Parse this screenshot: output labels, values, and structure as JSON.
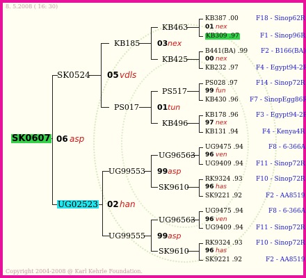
{
  "header": {
    "date": "8. 5.2008 ( 16: 30)"
  },
  "footer": {
    "copyright": "Copyright 2004-2008 @ Karl Kehrle Foundation."
  },
  "root": {
    "name": "SK0607",
    "num": "06",
    "col": "asp"
  },
  "sire": {
    "name": "SK0524",
    "num": "05",
    "col": "vdls"
  },
  "dam": {
    "name": "UG02523",
    "num": "02",
    "col": "han"
  },
  "gen3": [
    {
      "name": "KB185",
      "num": "03",
      "col": "nex"
    },
    {
      "name": "PS017",
      "num": "01",
      "col": "tun"
    },
    {
      "name": "UG99553",
      "num": "99",
      "col": "asp"
    },
    {
      "name": "UG99555",
      "num": "99",
      "col": "asp"
    }
  ],
  "gen4": [
    {
      "name": "KB463",
      "num": "01",
      "col": "nex"
    },
    {
      "name": "KB425",
      "num": "00",
      "col": "nex"
    },
    {
      "name": "PS517",
      "num": "99",
      "col": "fun"
    },
    {
      "name": "KB496",
      "num": "97",
      "col": "nex"
    },
    {
      "name": "UG96563",
      "num": "96",
      "col": "ven"
    },
    {
      "name": "SK9610",
      "num": "96",
      "col": "has"
    },
    {
      "name": "UG96563",
      "num": "96",
      "col": "ven"
    },
    {
      "name": "SK9610",
      "num": "96",
      "col": "has"
    }
  ],
  "gen5": [
    {
      "name": "KB387 .00",
      "info": "F18 - Sinop62R"
    },
    {
      "name": "KB309 .97",
      "info": "F1 - Sinop96R"
    },
    {
      "name": "B441(BA) .99",
      "info": "F2 - B166(BA)"
    },
    {
      "name": "KB232 .97",
      "info": "F4 - Egypt94-2R"
    },
    {
      "name": "PS028 .97",
      "info": "F14 - Sinop72R"
    },
    {
      "name": "KB430 .96",
      "info": "F7 - SinopEgg86R"
    },
    {
      "name": "KB178 .96",
      "info": "F3 - Egypt94-2R"
    },
    {
      "name": "KB131 .94",
      "info": "F4 - Kenya4R"
    },
    {
      "name": "UG9475 .94",
      "info": "F8 - 6-366A"
    },
    {
      "name": "UG9409 .94",
      "info": "F11 - Sinop72R"
    },
    {
      "name": "RK9324 .93",
      "info": "F10 - Sinop72R"
    },
    {
      "name": "SK9221 .92",
      "info": "F2 - AA8519"
    },
    {
      "name": "UG9475 .94",
      "info": "F8 - 6-366A"
    },
    {
      "name": "UG9409 .94",
      "info": "F11 - Sinop72R"
    },
    {
      "name": "RK9324 .93",
      "info": "F10 - Sinop72R"
    },
    {
      "name": "SK9221 .92",
      "info": "F2 - AA8519"
    }
  ]
}
